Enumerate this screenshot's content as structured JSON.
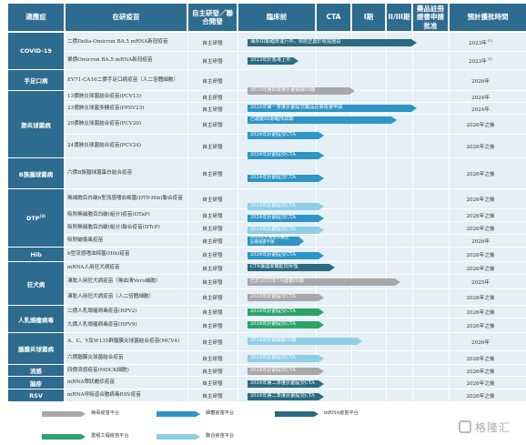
{
  "colors": {
    "header": "#2d6b8f",
    "row_bg": "#e4eff6",
    "virus_vector": "#a8a8a8",
    "bacteria": "#2e95c6",
    "mrna": "#2b6a80",
    "recombinant": "#2ca36a",
    "conjugate": "#8ecfe6"
  },
  "headers": {
    "indication": "適應症",
    "candidate": "在研疫苗",
    "rd": "自主研發／聯合開發",
    "preclinical": "臨床前",
    "cta": "CTA",
    "phase1": "I期",
    "phase23": "II/III期",
    "approval": "藥品註冊證書申請批准",
    "launch": "預計獲批時間"
  },
  "groups": [
    {
      "label": "COVID-19"
    },
    {
      "label": "手足口病"
    },
    {
      "label": "肺炎球菌病"
    },
    {
      "label": "B族腦球菌病"
    },
    {
      "label": "DTP",
      "sup": "(3)"
    },
    {
      "label": "Hib"
    },
    {
      "label": "狂犬病"
    },
    {
      "label": "人乳頭瘤病毒"
    },
    {
      "label": "腦膜炎球菌病"
    },
    {
      "label": "流感"
    },
    {
      "label": "脑疹"
    },
    {
      "label": "RSV"
    }
  ],
  "rows": [
    {
      "candidate": "二價Delta-Omicron BA.5 mRNA新冠疫苗",
      "rd": "自主研發",
      "status": "2023年",
      "status_sup": "(1)",
      "bar_label": "海外III期臨床進行中，目前正處於收尾階段",
      "bar_label2": ""
    },
    {
      "candidate": "單價Omicron BA.5 mRNA新冠疫苗",
      "rd": "自主研發",
      "status": "2023年",
      "status_sup": "(1)",
      "bar_label": "2023年於香港上市",
      "bar_label2": ""
    },
    {
      "candidate": "EV71-CA16二價手足口病疫苗（人二倍體細胞）",
      "rd": "自主研發",
      "status": "2026年",
      "status_sup": "",
      "bar_label": "2023年第四季度計劃開展III期",
      "bar_label2": ""
    },
    {
      "candidate": "13價肺炎球菌結合疫苗(PCV13)",
      "rd": "自主研發",
      "status": "2024年",
      "status_sup": "",
      "bar_label": "2024年第一季度計劃提交藥品註冊證書申請",
      "bar_label2": ""
    },
    {
      "candidate": "23價肺炎球菌多糖疫苗(PPSV23)",
      "rd": "自主研發",
      "status": "2024年",
      "status_sup": "",
      "bar_label": "已啟動III期臨床試驗",
      "bar_label2": ""
    },
    {
      "candidate": "20價肺炎球菌結合疫苗(PCV20)",
      "rd": "自主研發",
      "status": "2026年之後",
      "status_sup": "",
      "bar_label": "2024年計劃提交CTA",
      "bar_label2": ""
    },
    {
      "candidate": "24價肺炎球菌結合疫苗(PCV24)",
      "rd": "自主研發",
      "status": "2026年之後",
      "status_sup": "",
      "bar_label": "2024年計劃提交CTA",
      "bar_label2": ""
    },
    {
      "candidate": "六價B族腦球菌蛋白結合疫苗",
      "rd": "自主研發",
      "status": "2026年之後",
      "status_sup": "",
      "bar_label": "2024年計劃提交CTA",
      "bar_label2": ""
    },
    {
      "candidate": "無細胞百白破b型流感嗜血桿菌(DTP-Hib)聯合疫苗",
      "rd": "自主研發",
      "status": "2026年之後",
      "status_sup": "",
      "bar_label": "2024年計劃提交CTA",
      "bar_label2": ""
    },
    {
      "candidate": "吸附無細胞百白破(組分)疫苗(DTaP)",
      "rd": "自主研發",
      "status": "2026年之後",
      "status_sup": "",
      "bar_label": "2024年計劃提交CTA",
      "bar_label2": ""
    },
    {
      "candidate": "吸附無細胞百白破(組分)聯合疫苗(DTcP)",
      "rd": "自主研發",
      "status": "2026年之後",
      "status_sup": "",
      "bar_label": "2024年計劃提交CTA",
      "bar_label2": ""
    },
    {
      "candidate": "吸附破傷風疫苗",
      "rd": "自主研發",
      "status": "2026年",
      "status_sup": "",
      "bar_label": "2024年計劃提交藥品",
      "bar_label2": "註冊證書申請"
    },
    {
      "candidate": "b型流感嗜血桿菌(Hib)疫苗",
      "rd": "自主研發",
      "status": "2026年之後",
      "status_sup": "",
      "bar_label": "2024年計劃提交CTA",
      "bar_label2": ""
    },
    {
      "candidate": "mRNA人用狂犬病疫苗",
      "rd": "自主研發",
      "status": "2026年之後",
      "status_sup": "",
      "bar_label": "CTA獲國家藥監局受理",
      "bar_label2": ""
    },
    {
      "candidate": "凍乾人用狂犬病疫苗（無血清Vero細胞）",
      "rd": "自主研發",
      "status": "2025年",
      "status_sup": "",
      "bar_label": "已於2023年7月啟動III期",
      "bar_label2": ""
    },
    {
      "candidate": "凍乾人用狂犬病疫苗（人二倍體細胞）",
      "rd": "自主研發",
      "status": "2026年之後",
      "status_sup": "",
      "bar_label": "2024年計劃提交CTA",
      "bar_label2": ""
    },
    {
      "candidate": "二價人乳頭瘤病毒疫苗(HPV2)",
      "rd": "自主研發",
      "status": "2026年之後",
      "status_sup": "",
      "bar_label": "2024年計劃提交CTA",
      "bar_label2": ""
    },
    {
      "candidate": "九價人乳頭瘤病毒疫苗(HPV9)",
      "rd": "自主研發",
      "status": "2026年之後",
      "status_sup": "",
      "bar_label": "2024年計劃提交CTA",
      "bar_label2": ""
    },
    {
      "candidate": "A、C、Y及W135群腦膜炎球菌結合疫苗(MCV4)",
      "rd": "自主研發",
      "status": "2026年",
      "status_sup": "",
      "bar_label": "2024年計劃啟動III期",
      "bar_label2": ""
    },
    {
      "candidate": "六價腦膜炎球菌結合疫苗",
      "rd": "自主研發",
      "status": "2026年之後",
      "status_sup": "",
      "bar_label": "2024年計劃提交CTA",
      "bar_label2": ""
    },
    {
      "candidate": "四價流感疫苗(MDCK細胞)",
      "rd": "自主研發",
      "status": "2026年之後",
      "status_sup": "",
      "bar_label": "2024年計劃提交CTA",
      "bar_label2": ""
    },
    {
      "candidate": "mRNA帶狀皰疹疫苗",
      "rd": "自主研發",
      "status": "2026年之後",
      "status_sup": "",
      "bar_label": "2024年第二季度計劃提交CTA",
      "bar_label2": ""
    },
    {
      "candidate": "mRNA呼吸道合胞病毒RSV疫苗",
      "rd": "自主研發",
      "status": "2026年之後",
      "status_sup": "",
      "bar_label": "2024年第二季度計劃提交CTA",
      "bar_label2": ""
    }
  ],
  "legend": [
    {
      "label": "病毒疫苗平台"
    },
    {
      "label": "細菌疫苗平台"
    },
    {
      "label": "mRNA疫苗平台"
    },
    {
      "label": "重組工程疫苗平台"
    },
    {
      "label": "聯合疫苗平台"
    }
  ],
  "watermark": {
    "text": "格隆汇"
  }
}
